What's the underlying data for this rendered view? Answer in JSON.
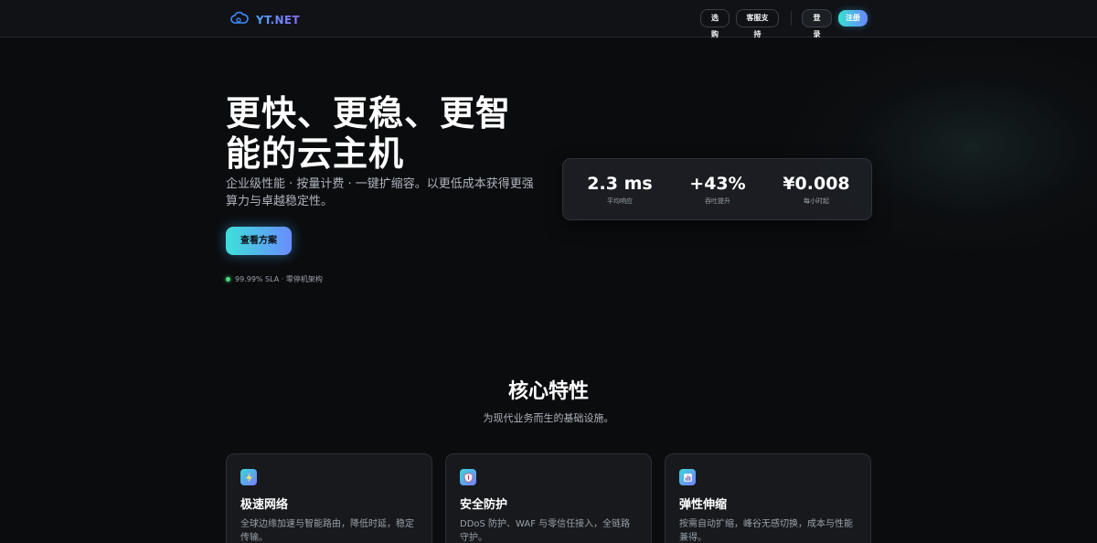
{
  "nav": {
    "brand": "YT.NET",
    "links": [
      "选购",
      "客服支持"
    ],
    "login": "登录",
    "register": "注册"
  },
  "hero": {
    "title": "更快、更稳、更智能的云主机",
    "subtitle": "企业级性能 · 按量计费 · 一键扩缩容。以更低成本获得更强算力与卓越稳定性。",
    "cta": "查看方案",
    "sla": "99.99% SLA · 零停机架构"
  },
  "stats": [
    {
      "value": "2.3 ms",
      "label": "平均响应"
    },
    {
      "value": "+43%",
      "label": "吞吐提升"
    },
    {
      "value": "¥0.008",
      "label": "每小时起"
    }
  ],
  "features": {
    "title": "核心特性",
    "subtitle": "为现代业务而生的基础设施。",
    "cards": [
      {
        "icon": "lightning-icon",
        "title": "极速网络",
        "desc": "全球边缘加速与智能路由，降低时延，稳定传输。"
      },
      {
        "icon": "shield-icon",
        "title": "安全防护",
        "desc": "DDoS 防护、WAF 与零信任接入，全链路守护。"
      },
      {
        "icon": "bar-chart-icon",
        "title": "弹性伸缩",
        "desc": "按需自动扩缩，峰谷无感切换，成本与性能兼得。"
      }
    ]
  },
  "colors": {
    "background": "#0b0c0e",
    "accent_start": "#3de0d8",
    "accent_end": "#6a8cff",
    "status_green": "#4ade80"
  }
}
